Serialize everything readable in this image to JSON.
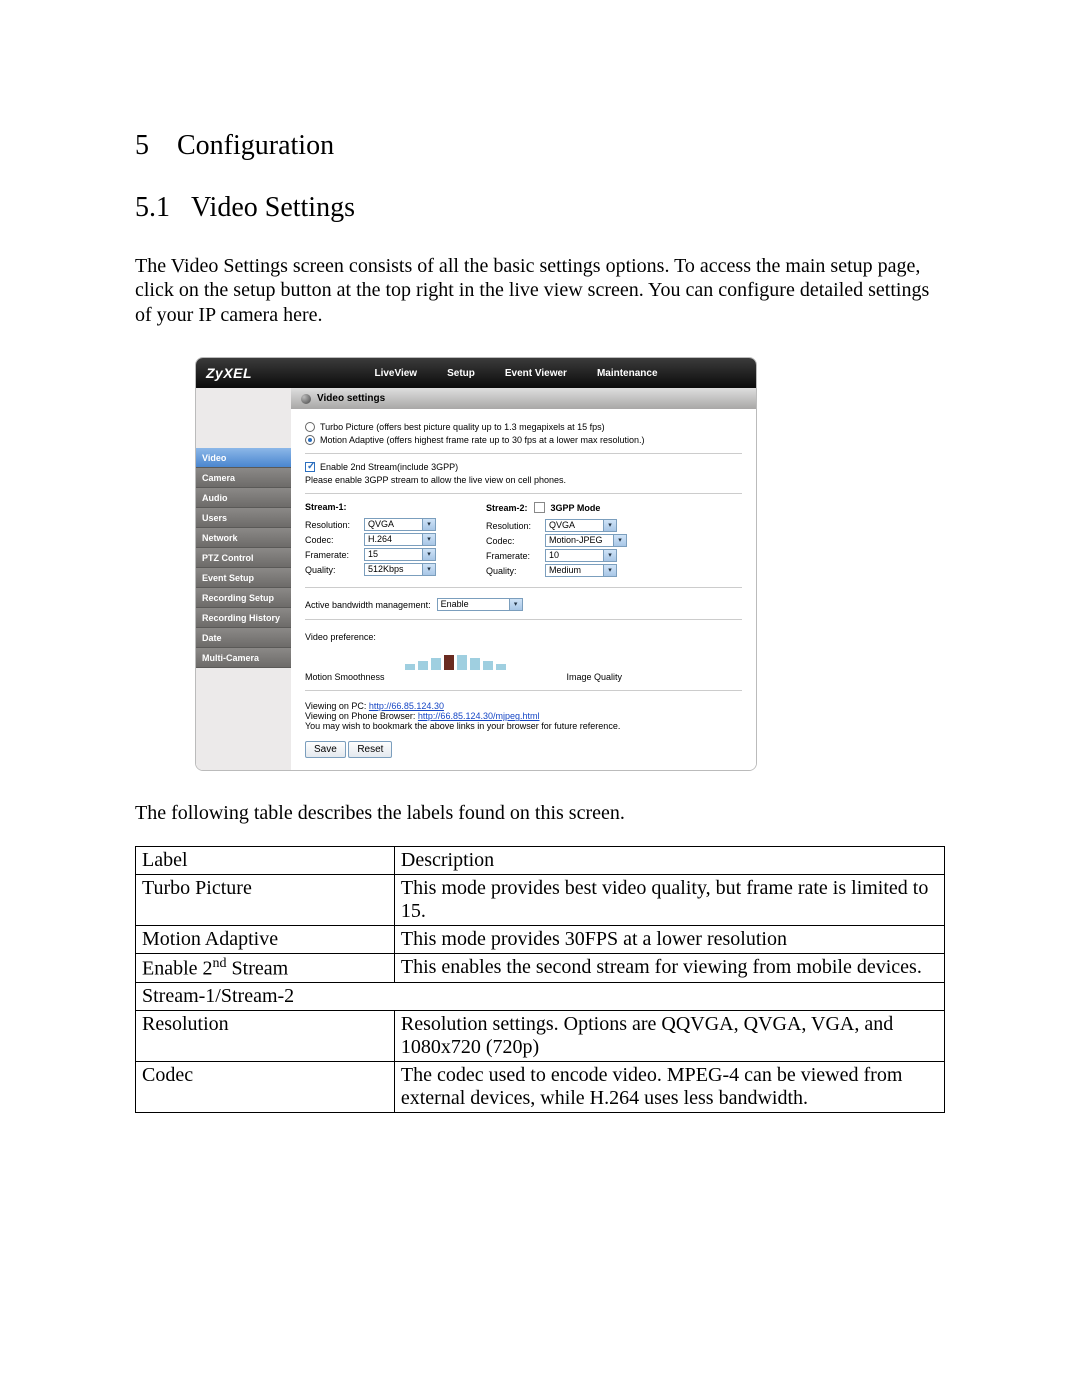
{
  "doc": {
    "section_number": "5",
    "section_title": "Configuration",
    "subsection_number": "5.1",
    "subsection_title": "Video Settings",
    "intro": "The Video Settings screen consists of all the basic settings options. To access the main setup page, click on the setup button at the top right in the live view screen. You can configure detailed settings of your IP camera here.",
    "table_intro": "The following table describes the labels found on this screen."
  },
  "shot": {
    "brand": "ZyXEL",
    "nav": [
      "LiveView",
      "Setup",
      "Event Viewer",
      "Maintenance"
    ],
    "sidebar": [
      "Video",
      "Camera",
      "Audio",
      "Users",
      "Network",
      "PTZ Control",
      "Event Setup",
      "Recording Setup",
      "Recording History",
      "Date",
      "Multi-Camera"
    ],
    "panel_title": "Video settings",
    "radio1": "Turbo Picture (offers best picture quality up to 1.3 megapixels at 15 fps)",
    "radio2": "Motion Adaptive (offers highest frame rate up to 30 fps at a lower max resolution.)",
    "enable2nd": "Enable 2nd Stream(include 3GPP)",
    "enable2nd_note": "Please enable 3GPP stream to allow the live view on cell phones.",
    "stream1_label": "Stream-1:",
    "stream2_label": "Stream-2:",
    "stream2_mode": "3GPP Mode",
    "fields": {
      "resolution": "Resolution:",
      "codec": "Codec:",
      "framerate": "Framerate:",
      "quality": "Quality:"
    },
    "stream1": {
      "resolution": "QVGA",
      "codec": "H.264",
      "framerate": "15",
      "quality": "512Kbps"
    },
    "stream2": {
      "resolution": "QVGA",
      "codec": "Motion-JPEG",
      "framerate": "10",
      "quality": "Medium"
    },
    "abm_label": "Active bandwidth management:",
    "abm_value": "Enable",
    "pref_label": "Video preference:",
    "pref_left": "Motion Smoothness",
    "pref_right": "Image Quality",
    "link_pc_label": "Viewing on PC:",
    "link_pc": "http://66.85.124.30",
    "link_phone_label": "Viewing on Phone Browser:",
    "link_phone": "http://66.85.124.30/mjpeg.html",
    "link_note": "You may wish to bookmark the above links in your browser for future reference.",
    "save": "Save",
    "reset": "Reset"
  },
  "table": {
    "headers": {
      "label": "Label",
      "description": "Description"
    },
    "rows": [
      {
        "label": "Turbo Picture",
        "desc": "This mode provides best video quality, but frame rate is limited to 15."
      },
      {
        "label": "Motion Adaptive",
        "desc": "This mode provides 30FPS at a lower resolution"
      },
      {
        "label_html": "Enable 2<span class=\"sup\">nd</span> Stream",
        "desc": "This enables the second stream for viewing from mobile devices."
      },
      {
        "label": "Stream-1/Stream-2",
        "span": true
      },
      {
        "label": "Resolution",
        "desc": "Resolution settings. Options are QQVGA, QVGA, VGA, and 1080x720 (720p)"
      },
      {
        "label": "Codec",
        "desc": "The codec used to encode video. MPEG-4 can be viewed from external devices, while H.264 uses less bandwidth."
      }
    ]
  },
  "chart_data": {
    "type": "bar",
    "title": "Video preference",
    "xlabel_left": "Motion Smoothness",
    "xlabel_right": "Image Quality",
    "values": [
      6,
      9,
      12,
      15,
      15,
      12,
      9,
      6
    ],
    "selected_index": 3,
    "ylim": [
      0,
      20
    ]
  }
}
